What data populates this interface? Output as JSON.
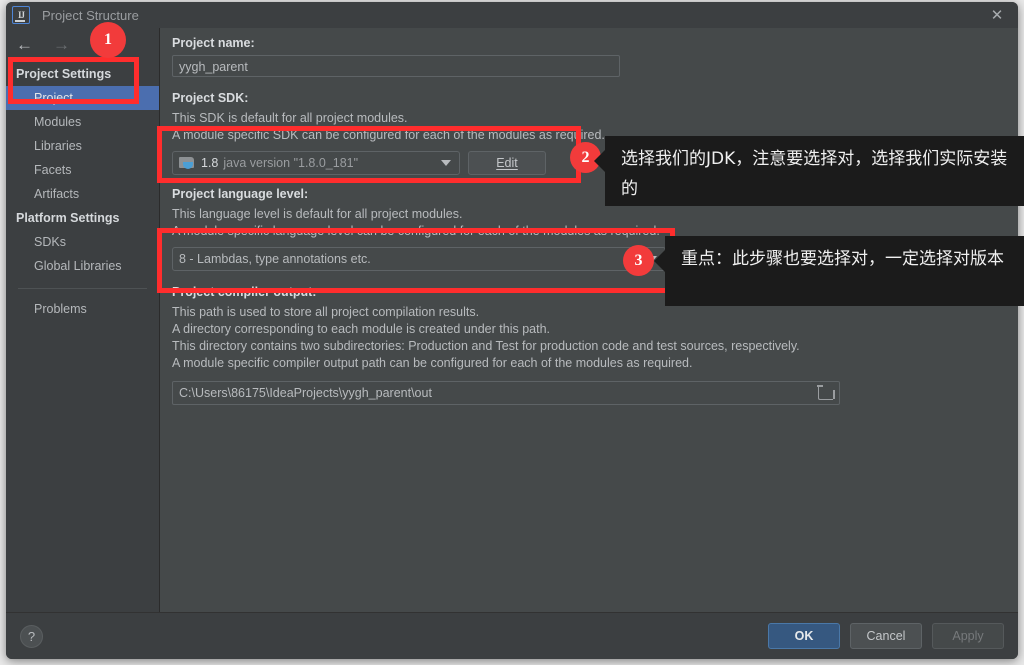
{
  "window": {
    "title": "Project Structure",
    "logo_icon": "intellij-idea-icon",
    "close_icon": "close-icon",
    "back_icon": "back-arrow-icon",
    "forward_icon": "forward-arrow-icon"
  },
  "sidebar": {
    "groups": [
      {
        "header": "Project Settings",
        "items": [
          {
            "label": "Project",
            "selected": true
          },
          {
            "label": "Modules",
            "selected": false
          },
          {
            "label": "Libraries",
            "selected": false
          },
          {
            "label": "Facets",
            "selected": false
          },
          {
            "label": "Artifacts",
            "selected": false
          }
        ]
      },
      {
        "header": "Platform Settings",
        "items": [
          {
            "label": "SDKs",
            "selected": false
          },
          {
            "label": "Global Libraries",
            "selected": false
          }
        ]
      }
    ],
    "extra_items": [
      {
        "label": "Problems"
      }
    ]
  },
  "main": {
    "project_name": {
      "label": "Project name:",
      "value": "yygh_parent"
    },
    "project_sdk": {
      "label": "Project SDK:",
      "desc_line1": "This SDK is default for all project modules.",
      "desc_line2": "A module specific SDK can be configured for each of the modules as required.",
      "sdk_icon": "java-sdk-icon",
      "sdk_version": "1.8",
      "sdk_description": "java version \"1.8.0_181\"",
      "dropdown_icon": "chevron-down-icon",
      "edit_button": "Edit"
    },
    "language_level": {
      "label": "Project language level:",
      "desc_line1": "This language level is default for all project modules.",
      "desc_line2": "A module specific language level can be configured for each of the modules as required.",
      "value": "8 - Lambdas, type annotations etc.",
      "dropdown_icon": "chevron-down-icon"
    },
    "compiler_output": {
      "label": "Project compiler output:",
      "desc_line1": "This path is used to store all project compilation results.",
      "desc_line2": "A directory corresponding to each module is created under this path.",
      "desc_line3": "This directory contains two subdirectories: Production and Test for production code and test sources, respectively.",
      "desc_line4": "A module specific compiler output path can be configured for each of the modules as required.",
      "path": "C:\\Users\\86175\\IdeaProjects\\yygh_parent\\out",
      "browse_icon": "folder-browse-icon"
    }
  },
  "footer": {
    "help_icon": "help-question-icon",
    "ok": "OK",
    "cancel": "Cancel",
    "apply": "Apply"
  },
  "annotations": {
    "badges": [
      {
        "number": "1"
      },
      {
        "number": "2"
      },
      {
        "number": "3"
      }
    ],
    "tooltips": [
      {
        "text": "选择我们的JDK，注意要选择对，选择我们实际安装的"
      },
      {
        "text": "重点：此步骤也要选择对，一定选择对版本"
      }
    ],
    "highlight_color": "#ff2d2d",
    "badge_color": "#f23b3b"
  }
}
